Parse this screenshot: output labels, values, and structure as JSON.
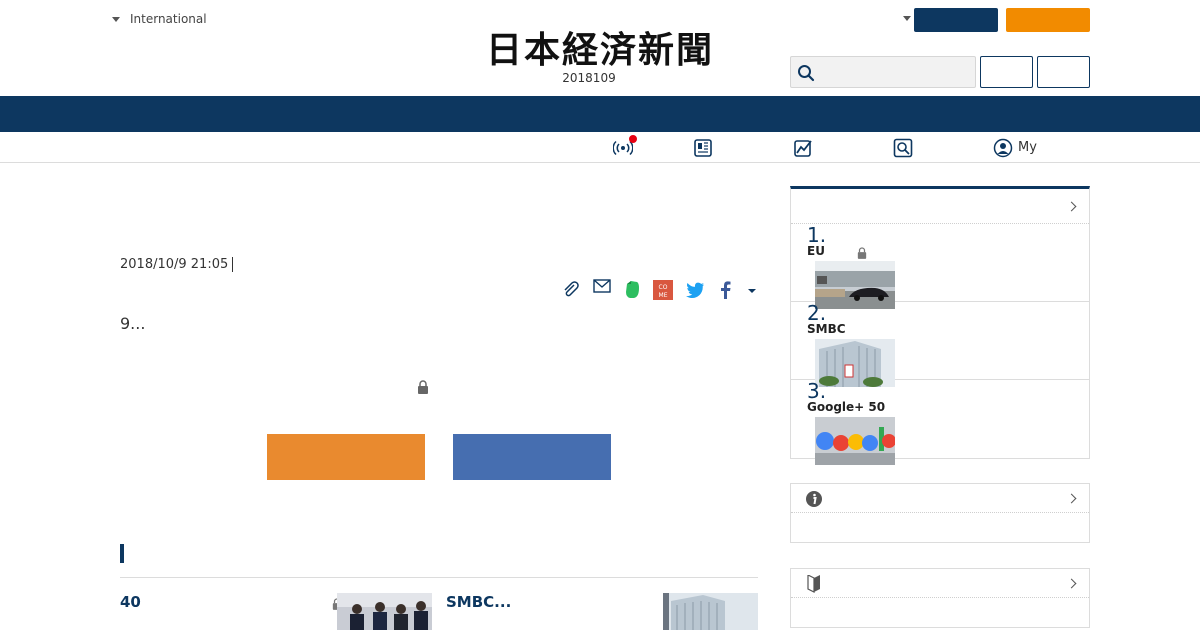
{
  "header": {
    "edition_label": "International",
    "logo_text": "日本経済新聞",
    "date_text": "2018109",
    "search": {
      "placeholder": "",
      "value": ""
    },
    "colors": {
      "navy": "#0d3760",
      "orange": "#f28b00"
    }
  },
  "subnav": {
    "items": [
      {
        "icon": "broadcast-icon",
        "label": ""
      },
      {
        "icon": "newspaper-icon",
        "label": ""
      },
      {
        "icon": "chart-icon",
        "label": ""
      },
      {
        "icon": "search-icon",
        "label": ""
      },
      {
        "icon": "user-icon",
        "label": "My"
      }
    ],
    "notification_dot_color": "#e60012"
  },
  "article": {
    "timestamp": "2018/10/9 21:05",
    "lead": "9...",
    "share_icons": [
      "clip-icon",
      "mail-icon",
      "evernote-icon",
      "come-icon",
      "twitter-icon",
      "facebook-icon",
      "caret-down-icon"
    ],
    "cta_colors": {
      "orange": "#e98a2f",
      "blue": "#466eb0"
    }
  },
  "related": {
    "items": [
      {
        "title": "40",
        "locked": true
      },
      {
        "title": "SMBC...",
        "locked": false
      }
    ]
  },
  "ranking": {
    "items": [
      {
        "rank": "1.",
        "title": "EU",
        "locked": true
      },
      {
        "rank": "2.",
        "title": "SMBC",
        "locked": false
      },
      {
        "rank": "3.",
        "title": "Google+ 50",
        "locked": false
      }
    ]
  },
  "side_boxes": [
    {
      "icon": "info-icon"
    },
    {
      "icon": "beginner-mark-icon"
    }
  ]
}
